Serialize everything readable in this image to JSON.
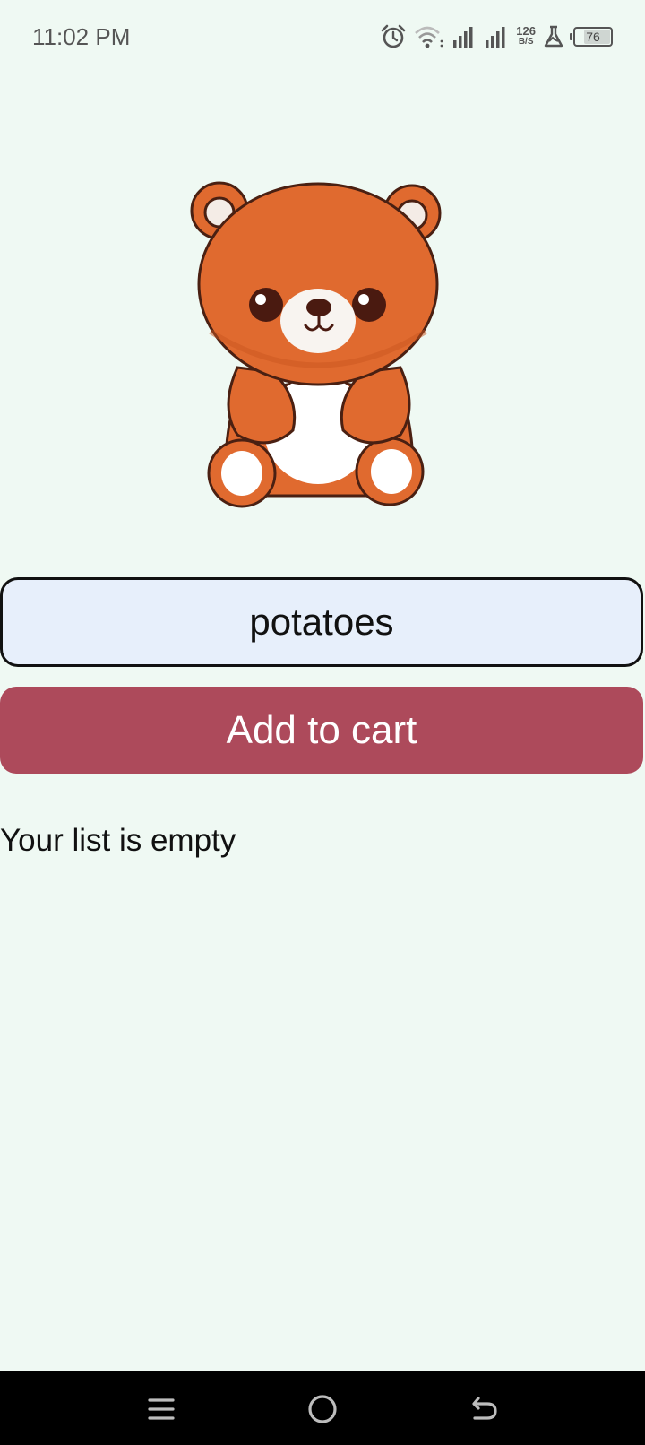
{
  "status_bar": {
    "time": "11:02 PM",
    "net_speed_value": "126",
    "net_speed_unit": "B/S",
    "battery_level": "76",
    "icons": [
      "alarm-icon",
      "wifi-icon",
      "signal-icon",
      "signal-icon",
      "lab-icon",
      "battery-icon"
    ]
  },
  "main": {
    "image": "teddy-bear-illustration",
    "input": {
      "value": "potatoes",
      "placeholder": ""
    },
    "add_button_label": "Add to cart",
    "empty_message": "Your list is empty"
  },
  "nav_bar": {
    "icons": [
      "menu-icon",
      "home-icon",
      "back-icon"
    ]
  },
  "colors": {
    "background": "#eff9f3",
    "button": "#ad4a5b",
    "input_bg": "#e7effb",
    "bear_fur": "#e06a2f",
    "bear_outline": "#4a2012"
  }
}
